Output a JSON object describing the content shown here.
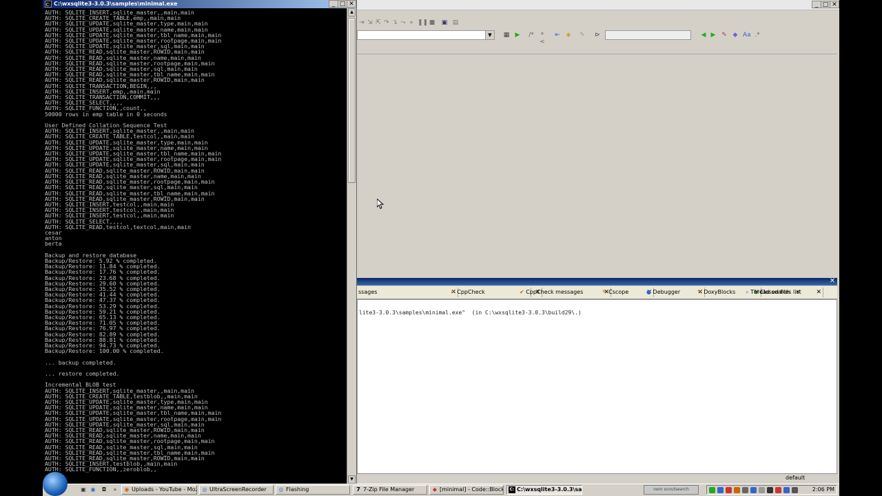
{
  "console": {
    "title": "C:\\wxsqlite3-3.0.3\\samples\\minimal.exe",
    "icon": "console-icon",
    "lines": [
      "AUTH: SQLITE_INSERT,sqlite_master,,main,main",
      "AUTH: SQLITE_CREATE_TABLE,emp,,main,main",
      "AUTH: SQLITE_UPDATE,sqlite_master,type,main,main",
      "AUTH: SQLITE_UPDATE,sqlite_master,name,main,main",
      "AUTH: SQLITE_UPDATE,sqlite_master,tbl_name,main,main",
      "AUTH: SQLITE_UPDATE,sqlite_master,rootpage,main,main",
      "AUTH: SQLITE_UPDATE,sqlite_master,sql,main,main",
      "AUTH: SQLITE_READ,sqlite_master,ROWID,main,main",
      "AUTH: SQLITE_READ,sqlite_master,name,main,main",
      "AUTH: SQLITE_READ,sqlite_master,rootpage,main,main",
      "AUTH: SQLITE_READ,sqlite_master,sql,main,main",
      "AUTH: SQLITE_READ,sqlite_master,tbl_name,main,main",
      "AUTH: SQLITE_READ,sqlite_master,ROWID,main,main",
      "AUTH: SQLITE_TRANSACTION,BEGIN,,,",
      "AUTH: SQLITE_INSERT,emp,,main,main",
      "AUTH: SQLITE_TRANSACTION,COMMIT,,,",
      "AUTH: SQLITE_SELECT,,,,",
      "AUTH: SQLITE_FUNCTION,,count,,",
      "50000 rows in emp table in 0 seconds",
      "",
      "User Defined Collation Sequence Test",
      "AUTH: SQLITE_INSERT,sqlite_master,,main,main",
      "AUTH: SQLITE_CREATE_TABLE,testcol,,main,main",
      "AUTH: SQLITE_UPDATE,sqlite_master,type,main,main",
      "AUTH: SQLITE_UPDATE,sqlite_master,name,main,main",
      "AUTH: SQLITE_UPDATE,sqlite_master,tbl_name,main,main",
      "AUTH: SQLITE_UPDATE,sqlite_master,rootpage,main,main",
      "AUTH: SQLITE_UPDATE,sqlite_master,sql,main,main",
      "AUTH: SQLITE_READ,sqlite_master,ROWID,main,main",
      "AUTH: SQLITE_READ,sqlite_master,name,main,main",
      "AUTH: SQLITE_READ,sqlite_master,rootpage,main,main",
      "AUTH: SQLITE_READ,sqlite_master,sql,main,main",
      "AUTH: SQLITE_READ,sqlite_master,tbl_name,main,main",
      "AUTH: SQLITE_READ,sqlite_master,ROWID,main,main",
      "AUTH: SQLITE_INSERT,testcol,,main,main",
      "AUTH: SQLITE_INSERT,testcol,,main,main",
      "AUTH: SQLITE_INSERT,testcol,,main,main",
      "AUTH: SQLITE_SELECT,,,,",
      "AUTH: SQLITE_READ,testcol,textcol,main,main",
      "cesar",
      "anton",
      "berta",
      "",
      "Backup and restore database",
      "Backup/Restore: 5.92 % completed.",
      "Backup/Restore: 11.84 % completed.",
      "Backup/Restore: 17.76 % completed.",
      "Backup/Restore: 23.68 % completed.",
      "Backup/Restore: 29.60 % completed.",
      "Backup/Restore: 35.52 % completed.",
      "Backup/Restore: 41.44 % completed.",
      "Backup/Restore: 47.37 % completed.",
      "Backup/Restore: 53.29 % completed.",
      "Backup/Restore: 59.21 % completed.",
      "Backup/Restore: 65.13 % completed.",
      "Backup/Restore: 71.05 % completed.",
      "Backup/Restore: 76.97 % completed.",
      "Backup/Restore: 82.89 % completed.",
      "Backup/Restore: 88.81 % completed.",
      "Backup/Restore: 94.73 % completed.",
      "Backup/Restore: 100.00 % completed.",
      "",
      "... backup completed.",
      "",
      "... restore completed.",
      "",
      "Incremental BLOB test",
      "AUTH: SQLITE_INSERT,sqlite_master,,main,main",
      "AUTH: SQLITE_CREATE_TABLE,testblob,,main,main",
      "AUTH: SQLITE_UPDATE,sqlite_master,type,main,main",
      "AUTH: SQLITE_UPDATE,sqlite_master,name,main,main",
      "AUTH: SQLITE_UPDATE,sqlite_master,tbl_name,main,main",
      "AUTH: SQLITE_UPDATE,sqlite_master,rootpage,main,main",
      "AUTH: SQLITE_UPDATE,sqlite_master,sql,main,main",
      "AUTH: SQLITE_READ,sqlite_master,ROWID,main,main",
      "AUTH: SQLITE_READ,sqlite_master,name,main,main",
      "AUTH: SQLITE_READ,sqlite_master,rootpage,main,main",
      "AUTH: SQLITE_READ,sqlite_master,sql,main,main",
      "AUTH: SQLITE_READ,sqlite_master,tbl_name,main,main",
      "AUTH: SQLITE_READ,sqlite_master,ROWID,main,main",
      "AUTH: SQLITE_INSERT,testblob,,main,main",
      "AUTH: SQLITE_FUNCTION,,zeroblob,,"
    ],
    "text_color": "#c0c0c0",
    "background": "#000000"
  },
  "window_controls": {
    "minimize": "_",
    "maximize": "□",
    "close": "✕"
  },
  "codeblocks": {
    "logs": {
      "close_glyph": "✕",
      "tabs": [
        {
          "label": "ssages",
          "icon": ""
        },
        {
          "label": "CppCheck",
          "icon": "check-icon"
        },
        {
          "label": "CppCheck messages",
          "icon": "check-icon"
        },
        {
          "label": "Cscope",
          "icon": "cscope-icon"
        },
        {
          "label": "Debugger",
          "icon": "debugger-icon"
        },
        {
          "label": "DoxyBlocks",
          "icon": "doxyblocks-icon"
        },
        {
          "label": "Closed files list",
          "icon": "closed-files-icon"
        },
        {
          "label": "Thread search",
          "icon": "thread-search-icon"
        }
      ],
      "build_log_line": "lite3-3.0.3\\samples\\minimal.exe\"  (in C:\\wxsqlite3-3.0.3\\build29\\.)"
    },
    "status": {
      "default_label": "default"
    },
    "header_color": "#0a246a"
  },
  "taskbar": {
    "items": [
      {
        "label": "Uploads - YouTube - Moz...",
        "icon": "firefox-icon",
        "active": false
      },
      {
        "label": "UltraScreenRecorder",
        "icon": "recorder-icon",
        "active": false
      },
      {
        "label": "Flashing",
        "icon": "flashing-icon",
        "active": false
      },
      {
        "label": "7-Zip File Manager",
        "icon": "7zip-icon",
        "active": false
      },
      {
        "label": "[minimal] - Code::Blocks ...",
        "icon": "codeblocks-icon",
        "active": false
      },
      {
        "label": "C:\\wxsqlite3-3.0.3\\sa...",
        "icon": "console-icon",
        "active": true
      }
    ],
    "clock": "2:06 PM",
    "nero_label": "nero scoutsearch"
  }
}
